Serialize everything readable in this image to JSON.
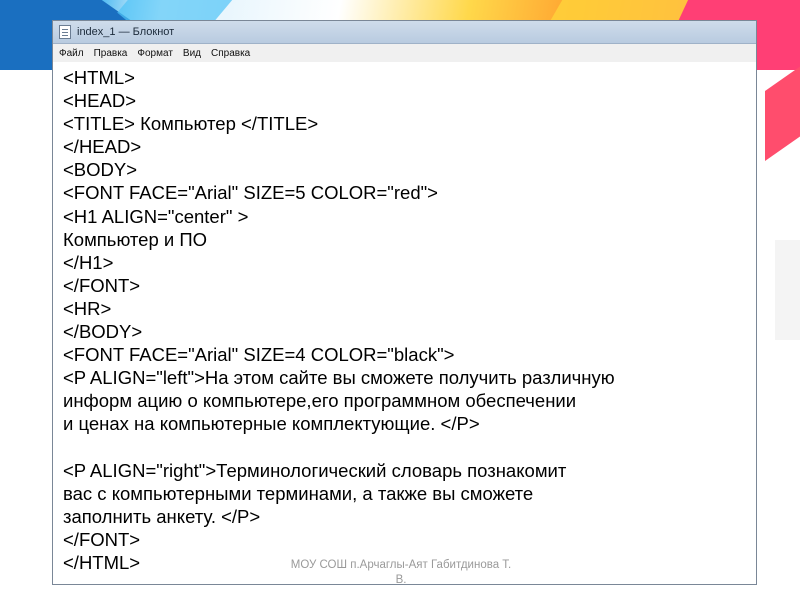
{
  "window": {
    "title": "index_1 — Блокнот",
    "menu": [
      "Файл",
      "Правка",
      "Формат",
      "Вид",
      "Справка"
    ]
  },
  "editor": {
    "lines": [
      "<HTML>",
      "<HEAD>",
      "<TITLE> Компьютер </TITLE>",
      "</HEAD>",
      "<BODY>",
      "<FONT FACE=\"Arial\" SIZE=5 COLOR=\"red\">",
      "<H1 ALIGN=\"center\" >",
      "Компьютер и ПО",
      "</H1>",
      "</FONT>",
      "<HR>",
      "</BODY>",
      "<FONT FACE=\"Arial\" SIZE=4 COLOR=\"black\">",
      "<P ALIGN=\"left\">На этом сайте вы сможете получить различную",
      "информ ацию о компьютере,его программном обеспечении",
      "и ценах на компьютерные комплектующие. </P>",
      "",
      "<P ALIGN=\"right\">Терминологический словарь познакомит",
      "вас с компьютерными терминами, а также вы сможете",
      "заполнить анкету. </P>",
      "</FONT>",
      "</HTML>"
    ]
  },
  "footer": {
    "line1": "МОУ СОШ п.Арчаглы-Аят Габитдинова Т.",
    "line2": "В."
  }
}
